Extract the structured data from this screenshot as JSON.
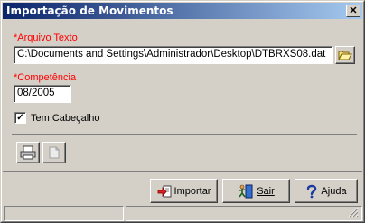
{
  "window": {
    "title": "Importação de Movimentos",
    "close_symbol": "✕"
  },
  "form": {
    "arquivo_label": "*Arquivo Texto",
    "arquivo_value": "C:\\Documents and Settings\\Administrador\\Desktop\\DTBRXS08.dat",
    "competencia_label": "*Competência",
    "competencia_value": "08/2005",
    "cabecalho_label": "Tem Cabeçalho",
    "cabecalho_checked": true,
    "check_mark": "✓"
  },
  "buttons": {
    "importar_label": "Importar",
    "sair_label": "Sair",
    "ajuda_label": "Ajuda"
  },
  "icons": {
    "folder": "folder-open-icon",
    "print": "printer-icon",
    "document": "document-icon",
    "importar": "import-icon",
    "sair": "exit-icon",
    "ajuda": "help-icon"
  },
  "colors": {
    "title_gradient_start": "#0a246a",
    "title_gradient_end": "#a6caf0",
    "required_label": "#ff0000",
    "face": "#d4d0c8"
  }
}
